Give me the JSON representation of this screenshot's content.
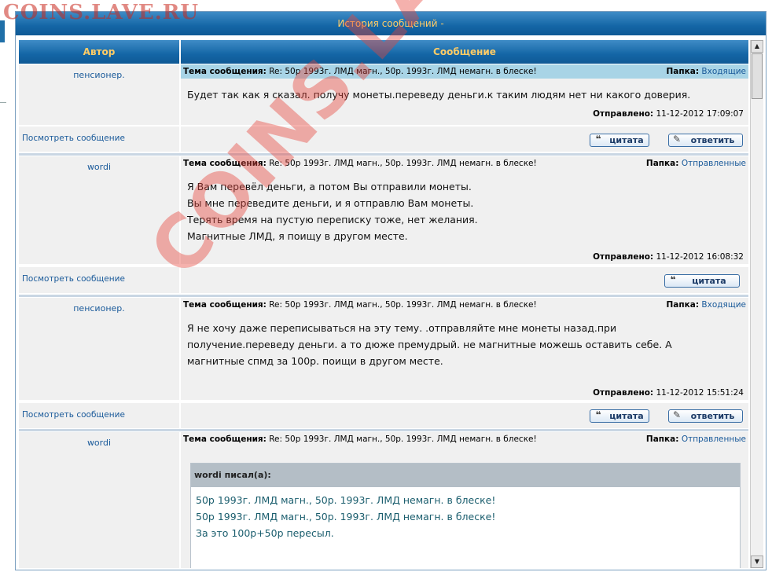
{
  "watermark_top": "COINS.LAVE.RU",
  "watermark_diag": "COINS.LAVE.RU",
  "window": {
    "title": "История сообщений -"
  },
  "table": {
    "col_author": "Автор",
    "col_message": "Сообщение",
    "subject_label": "Тема сообщения:",
    "folder_label": "Папка:",
    "sent_label": "Отправлено:",
    "view_link": "Посмотреть сообщение",
    "quote_button": "цитата",
    "reply_button": "ответить",
    "rows": [
      {
        "author": "пенсионер.",
        "subject": "Re: 50р 1993г. ЛМД магн., 50р. 1993г. ЛМД немагн. в блеске!",
        "folder": "Входящие",
        "lines": [
          "Будет так как я сказал. получу монеты.переведу деньги.к таким людям нет ни какого доверия."
        ],
        "sent": "11-12-2012 17:09:07"
      },
      {
        "author": "wordi",
        "subject": "Re: 50р 1993г. ЛМД магн., 50р. 1993г. ЛМД немагн. в блеске!",
        "folder": "Отправленные",
        "lines": [
          "Я Вам перевёл деньги, а потом Вы отправили монеты.",
          "Вы мне переведите деньги, и я отправлю Вам монеты.",
          "Терять время на пустую переписку тоже, нет желания.",
          "Магнитные ЛМД, я поищу в другом месте."
        ],
        "sent": "11-12-2012 16:08:32"
      },
      {
        "author": "пенсионер.",
        "subject": "Re: 50р 1993г. ЛМД магн., 50р. 1993г. ЛМД немагн. в блеске!",
        "folder": "Входящие",
        "lines": [
          "Я не хочу даже переписываться на эту тему. .отправляйте мне монеты назад.при",
          "получение.переведу деньги. а то дюже премудрый. не магнитные можешь оставить себе. А",
          "магнитные спмд за 100р. поищи в другом месте."
        ],
        "sent": "11-12-2012 15:51:24"
      },
      {
        "author": "wordi",
        "subject": "Re: 50р 1993г. ЛМД магн., 50р. 1993г. ЛМД немагн. в блеске!",
        "folder": "Отправленные",
        "quote_header": "wordi писал(а):",
        "quote_lines": [
          "50р 1993г. ЛМД магн., 50р. 1993г. ЛМД немагн. в блеске!",
          "50р 1993г. ЛМД магн., 50р. 1993г. ЛМД немагн. в блеске!",
          "За это 100р+50р пересыл."
        ]
      }
    ]
  }
}
